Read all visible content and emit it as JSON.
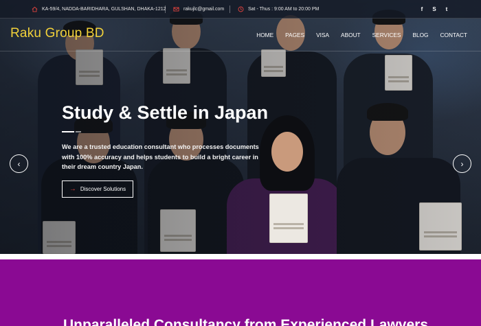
{
  "topbar": {
    "address": "KA-59/4, NADDA-BARIDHARA, GULSHAN, DHAKA-1212",
    "email": "rakujlc@gmail.com",
    "hours": "Sat - Thus : 9:00 AM to 20:00 PM",
    "social": {
      "facebook": "f",
      "skype": "S",
      "twitter": "t"
    }
  },
  "brand": {
    "name": "Raku Group BD",
    "color": "#f2d13a"
  },
  "nav": [
    "HOME",
    "PAGES",
    "VISA",
    "ABOUT",
    "SERVICES",
    "BLOG",
    "CONTACT"
  ],
  "hero": {
    "title": "Study & Settle in Japan",
    "description": "We are a trusted education consultant who processes documents with 100% accuracy and helps students to build a bright career in their dream country Japan.",
    "cta_label": "Discover Solutions",
    "prev_label": "‹",
    "next_label": "›"
  },
  "section": {
    "title": "Unparalleled Consultancy from Experienced Lawyers",
    "background": "#8a0a93"
  }
}
